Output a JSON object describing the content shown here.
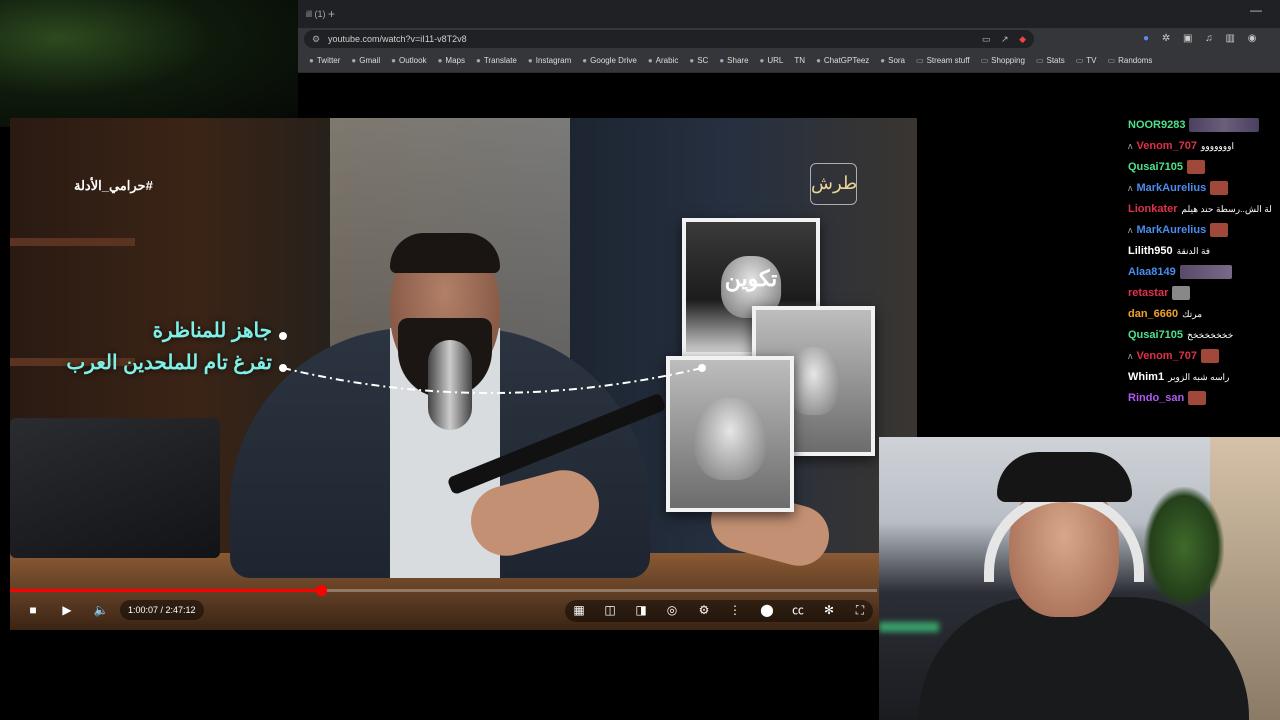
{
  "browser": {
    "tab_title": "ill (1)",
    "new_tab": "+",
    "minimize": "—",
    "url": "youtube.com/watch?v=iI11-v8T2v8",
    "bookmarks": [
      {
        "label": "Twitter",
        "icon": "x-icon"
      },
      {
        "label": "Gmail",
        "icon": "gmail-icon"
      },
      {
        "label": "Outlook",
        "icon": "outlook-icon"
      },
      {
        "label": "Maps",
        "icon": "maps-icon"
      },
      {
        "label": "Translate",
        "icon": "translate-icon"
      },
      {
        "label": "Instagram",
        "icon": "instagram-icon"
      },
      {
        "label": "Google Drive",
        "icon": "drive-icon"
      },
      {
        "label": "Arabic",
        "icon": "arabic-icon"
      },
      {
        "label": "SC",
        "icon": "sc-icon"
      },
      {
        "label": "Share",
        "icon": "share-icon"
      },
      {
        "label": "URL",
        "icon": "url-icon"
      },
      {
        "label": "TN",
        "icon": ""
      },
      {
        "label": "ChatGPTeez",
        "icon": "chatgpt-icon"
      },
      {
        "label": "Sora",
        "icon": "sora-icon"
      },
      {
        "label": "Stream stuff",
        "icon": "folder-icon"
      },
      {
        "label": "Shopping",
        "icon": "folder-icon"
      },
      {
        "label": "Stats",
        "icon": "folder-icon"
      },
      {
        "label": "TV",
        "icon": "folder-icon"
      },
      {
        "label": "Randoms",
        "icon": "folder-icon"
      }
    ]
  },
  "video": {
    "hashtag": "#حرامي_الأدلة",
    "overlay_line1": "جاهز للمناظرة",
    "overlay_line2": "تفرغ تام للملحدين العرب",
    "photo_text": "تكوين",
    "logo": "طرش",
    "current_time": "1:00:07",
    "duration": "2:47:12",
    "time_display": "1:00:07 / 2:47:12",
    "progress_fraction": 0.359
  },
  "chat": [
    {
      "name": "NOOR9283",
      "color": "#4fe08a",
      "msg": "",
      "badge": "wide",
      "reply": false
    },
    {
      "name": "Venom_707",
      "color": "#e0304a",
      "msg": "اووووووو",
      "badge": "",
      "reply": true
    },
    {
      "name": "Qusai7105",
      "color": "#4fe08a",
      "msg": "",
      "badge": "normal",
      "reply": false
    },
    {
      "name": "MarkAurelius",
      "color": "#4a8cf0",
      "msg": "",
      "badge": "normal",
      "reply": true
    },
    {
      "name": "Lionkater",
      "color": "#e0304a",
      "msg": "لة الش..رسطة حند هيلم",
      "badge": "",
      "reply": false
    },
    {
      "name": "MarkAurelius",
      "color": "#4a8cf0",
      "msg": "",
      "badge": "normal",
      "reply": true
    },
    {
      "name": "Lilith950",
      "color": "#ffffff",
      "msg": "فة الدنقة",
      "badge": "",
      "reply": false
    },
    {
      "name": "Alaa8149",
      "color": "#4a8cf0",
      "msg": "",
      "badge": "mid",
      "reply": false
    },
    {
      "name": "retastar",
      "color": "#e0304a",
      "msg": "",
      "badge": "gray",
      "reply": false
    },
    {
      "name": "dan_6660",
      "color": "#f0a030",
      "msg": "مرتك",
      "badge": "",
      "reply": false
    },
    {
      "name": "Qusai7105",
      "color": "#4fe08a",
      "msg": "خخخخخخخخ",
      "badge": "",
      "reply": false
    },
    {
      "name": "Venom_707",
      "color": "#e0304a",
      "msg": "",
      "badge": "normal",
      "reply": true
    },
    {
      "name": "Whim1",
      "color": "#ffffff",
      "msg": "راسه شبه الزوبر",
      "badge": "",
      "reply": false
    },
    {
      "name": "Rindo_san",
      "color": "#b05af0",
      "msg": "",
      "badge": "normal",
      "reply": false
    }
  ]
}
